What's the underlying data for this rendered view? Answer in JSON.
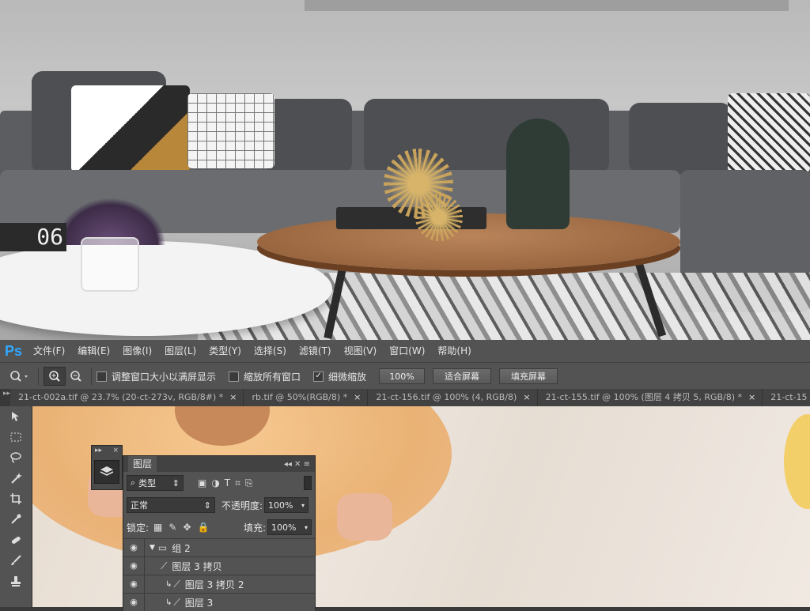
{
  "scene": {
    "clock_digits": "06"
  },
  "menubar": {
    "logo": "Ps",
    "items": [
      "文件(F)",
      "编辑(E)",
      "图像(I)",
      "图层(L)",
      "类型(Y)",
      "选择(S)",
      "滤镜(T)",
      "视图(V)",
      "窗口(W)",
      "帮助(H)"
    ]
  },
  "options": {
    "resize_windows_label": "调整窗口大小以满屏显示",
    "zoom_all_label": "缩放所有窗口",
    "scrubby_zoom_label": "细微缩放",
    "pct_button": "100%",
    "fit_screen_button": "适合屏幕",
    "fill_screen_button": "填充屏幕"
  },
  "tabs": [
    {
      "title": "21-ct-002a.tif @ 23.7% (20-ct-273v, RGB/8#) *"
    },
    {
      "title": "rb.tif @ 50%(RGB/8) *"
    },
    {
      "title": "21-ct-156.tif @ 100% (4, RGB/8)"
    },
    {
      "title": "21-ct-155.tif @ 100% (图层 4 拷贝 5, RGB/8) *"
    },
    {
      "title": "21-ct-15"
    }
  ],
  "layers_panel": {
    "title": "图层",
    "filter_label": "类型",
    "blend_mode": "正常",
    "opacity_label": "不透明度:",
    "opacity_value": "100%",
    "lock_label": "锁定:",
    "fill_label": "填充:",
    "fill_value": "100%",
    "layers": [
      {
        "name": "组 2",
        "kind": "group"
      },
      {
        "name": "图层 3 拷贝",
        "kind": "paint"
      },
      {
        "name": "图层 3 拷贝 2",
        "kind": "paint-clipped"
      },
      {
        "name": "图层 3",
        "kind": "paint-clipped"
      }
    ]
  },
  "colors": {
    "ps_blue": "#31a8ff",
    "chrome": "#535353",
    "chrome_dark": "#424242"
  }
}
